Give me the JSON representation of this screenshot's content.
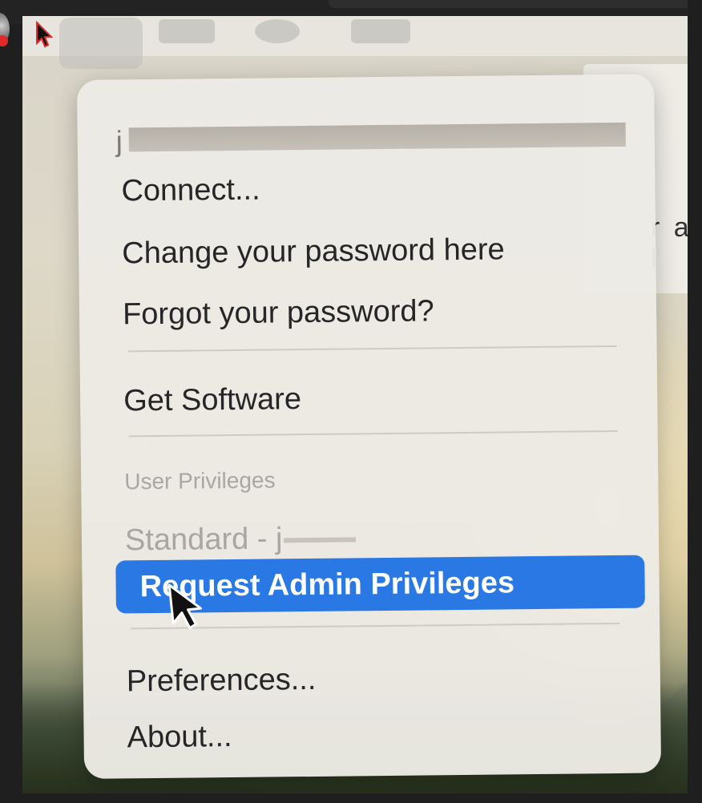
{
  "menu": {
    "user_initial": "j",
    "items": [
      {
        "label": "Connect..."
      },
      {
        "label": "Change your password here"
      },
      {
        "label": "Forgot your password?"
      },
      {
        "label": "Get Software"
      }
    ],
    "privileges_section": {
      "header": "User Privileges",
      "status": "Standard - j",
      "action": "Request Admin Privileges"
    },
    "footer_items": [
      {
        "label": "Preferences..."
      },
      {
        "label": "About..."
      }
    ]
  },
  "background_window": {
    "partial_text": "r a l"
  },
  "colors": {
    "highlight": "#2a78e4",
    "menu_bg": "#ecEAe4",
    "recording_dot": "#e02a2a"
  }
}
